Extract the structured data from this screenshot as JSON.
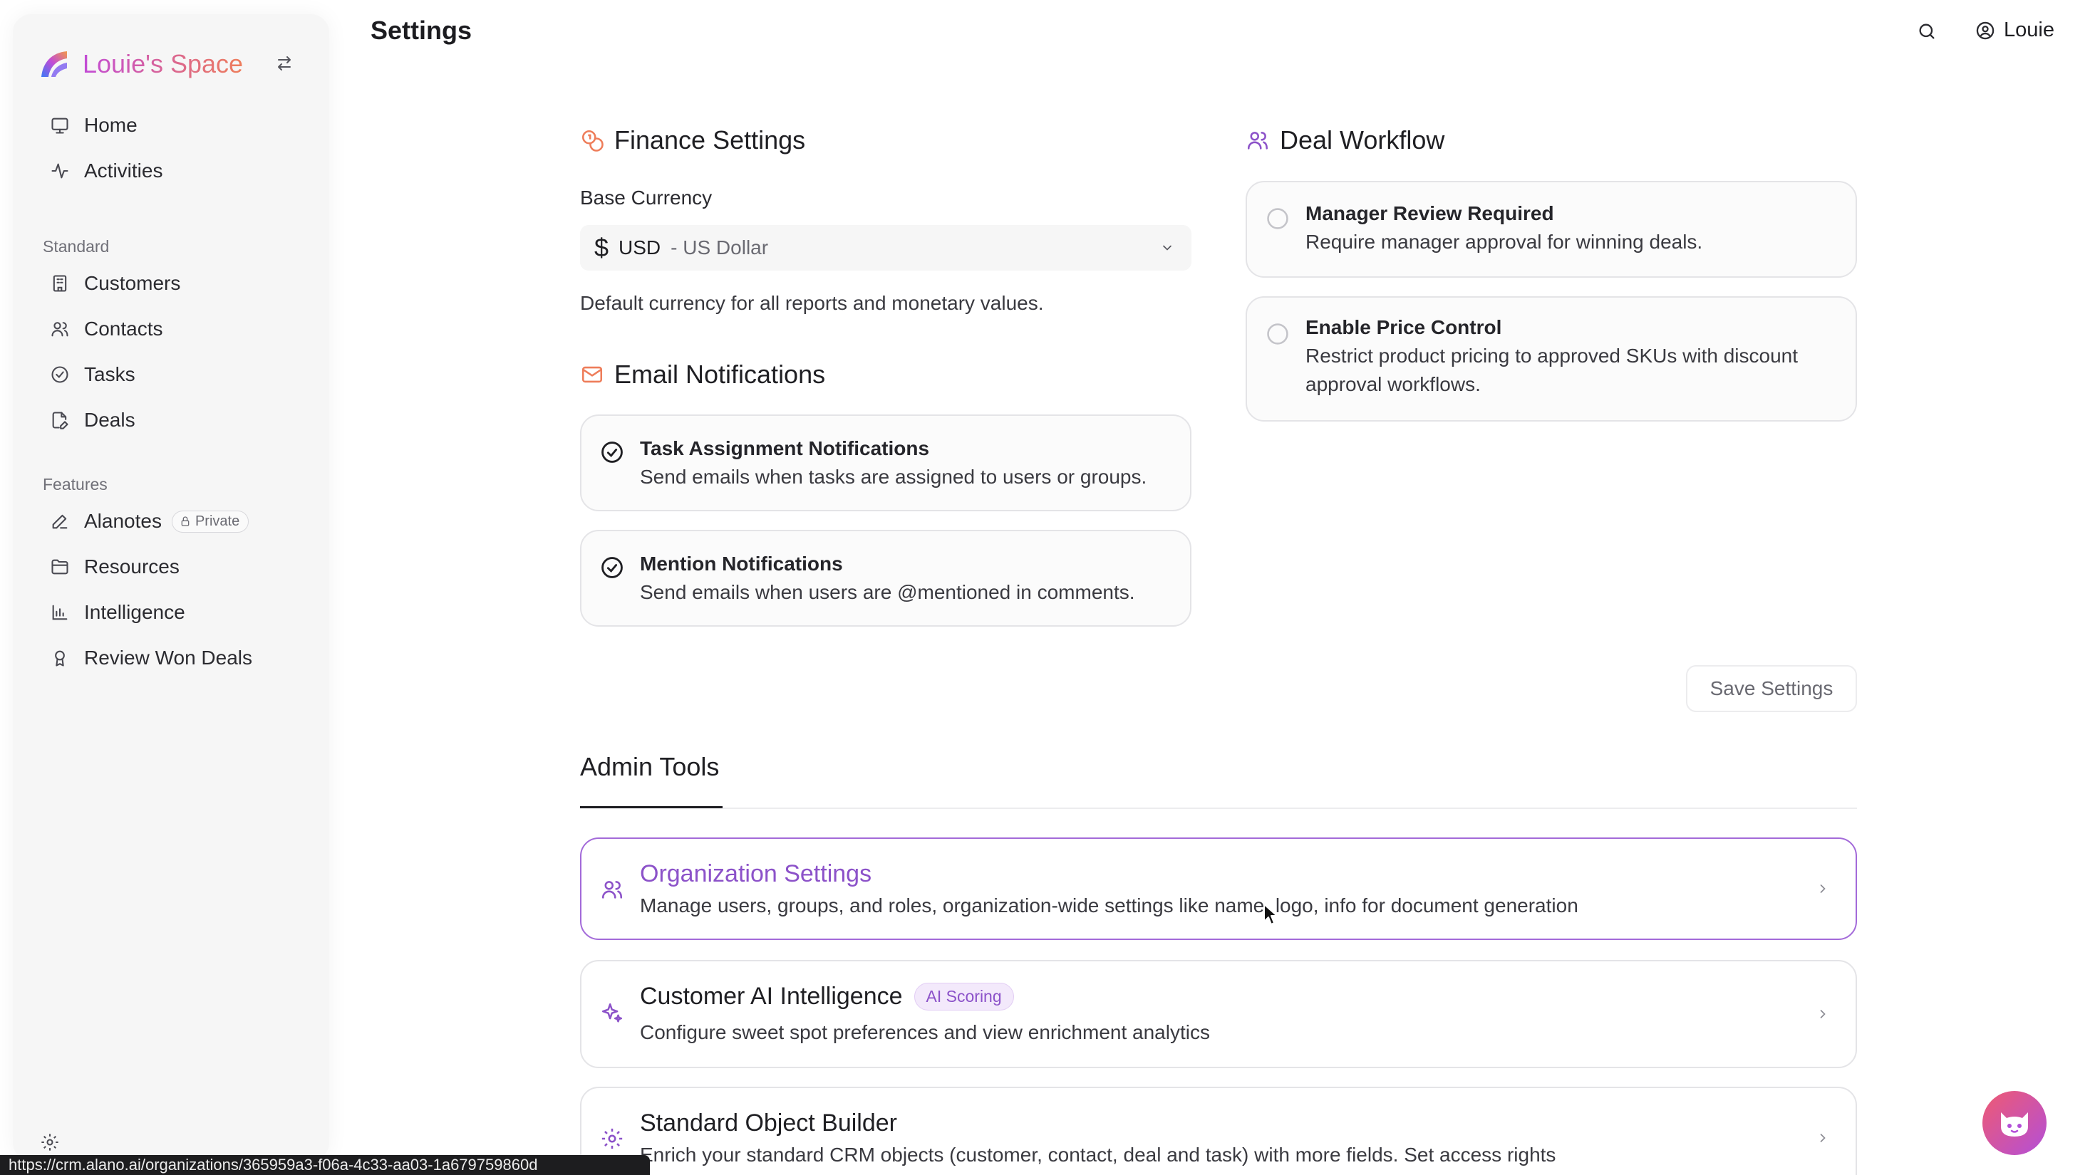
{
  "brand": {
    "name": "Louie's Space"
  },
  "nav": {
    "home": "Home",
    "activities": "Activities",
    "standard_header": "Standard",
    "customers": "Customers",
    "contacts": "Contacts",
    "tasks": "Tasks",
    "deals": "Deals",
    "features_header": "Features",
    "alanotes": "Alanotes",
    "alanotes_badge": "Private",
    "resources": "Resources",
    "intelligence": "Intelligence",
    "review_won_deals": "Review Won Deals"
  },
  "header": {
    "title": "Settings",
    "user_name": "Louie"
  },
  "finance": {
    "title": "Finance Settings",
    "base_currency_label": "Base Currency",
    "currency_symbol": "$",
    "currency_code": "USD",
    "currency_name": "- US Dollar",
    "helper": "Default currency for all reports and monetary values."
  },
  "email": {
    "title": "Email Notifications",
    "options": [
      {
        "title": "Task Assignment Notifications",
        "desc": "Send emails when tasks are assigned to users or groups.",
        "checked": true
      },
      {
        "title": "Mention Notifications",
        "desc": "Send emails when users are @mentioned in comments.",
        "checked": true
      }
    ]
  },
  "deal_workflow": {
    "title": "Deal Workflow",
    "options": [
      {
        "title": "Manager Review Required",
        "desc": "Require manager approval for winning deals.",
        "checked": false
      },
      {
        "title": "Enable Price Control",
        "desc": "Restrict product pricing to approved SKUs with discount approval workflows.",
        "checked": false
      }
    ]
  },
  "save_label": "Save Settings",
  "admin": {
    "title": "Admin Tools",
    "tools": [
      {
        "title": "Organization Settings",
        "desc": "Manage users, groups, and roles, organization-wide settings like name, logo, info for document generation"
      },
      {
        "title": "Customer AI Intelligence",
        "badge": "AI Scoring",
        "desc": "Configure sweet spot preferences and view enrichment analytics"
      },
      {
        "title": "Standard Object Builder",
        "desc": "Enrich your standard CRM objects (customer, contact, deal and task) with more fields. Set access rights"
      }
    ]
  },
  "status_url": "https://crm.alano.ai/organizations/365959a3-f06a-4c33-aa03-1a679759860d",
  "colors": {
    "accent": "#8c52c9",
    "brand_start": "#c24bd6",
    "brand_end": "#ee7d5a",
    "icon_orange": "#ee7d5a",
    "icon_purple": "#8c52c9"
  }
}
